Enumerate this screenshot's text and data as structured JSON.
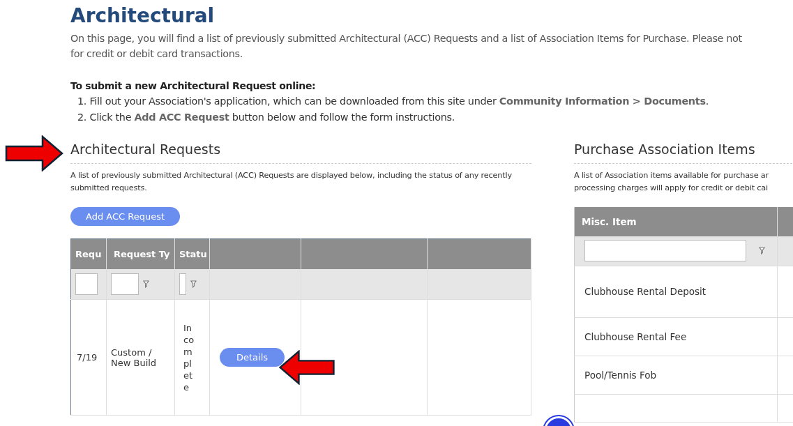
{
  "page": {
    "title": "Architectural",
    "intro_lines": [
      "On this page, you will find a list of previously submitted Architectural (ACC) Requests and a list of Association Items for Purchase. Please not",
      "for credit or debit card transactions."
    ],
    "instructions_heading": "To submit a new Architectural Request online:",
    "steps": [
      "1. Fill out your Association's application, which can be downloaded from this site under **Community Information > Documents**.",
      "2. Click the **Add ACC Request** button below and follow the form instructions."
    ]
  },
  "requests": {
    "heading": "Architectural Requests",
    "description": "A list of previously submitted Architectural (ACC) Requests are displayed below, including the status of any recently submitted requests.",
    "add_button": "Add ACC Request",
    "columns": [
      {
        "kind": "filter",
        "label": "Requ"
      },
      {
        "kind": "filter",
        "label": "Request Ty"
      },
      {
        "kind": "filter",
        "label": "Statu"
      },
      {
        "kind": "blank"
      },
      {
        "kind": "blank"
      },
      {
        "kind": "blank"
      }
    ],
    "rows": [
      {
        "date": "7/19",
        "type": "Custom / New Build",
        "status": "Incomplete",
        "action": "Details"
      }
    ]
  },
  "purchase": {
    "heading": "Purchase Association Items",
    "description_lines": [
      "A list of Association items available for purchase ar",
      "processing charges will apply for credit or debit cai"
    ],
    "column": "Misc. Item",
    "rows": [
      "Clubhouse Rental Deposit",
      "Clubhouse Rental Fee",
      "Pool/Tennis Fob"
    ]
  }
}
